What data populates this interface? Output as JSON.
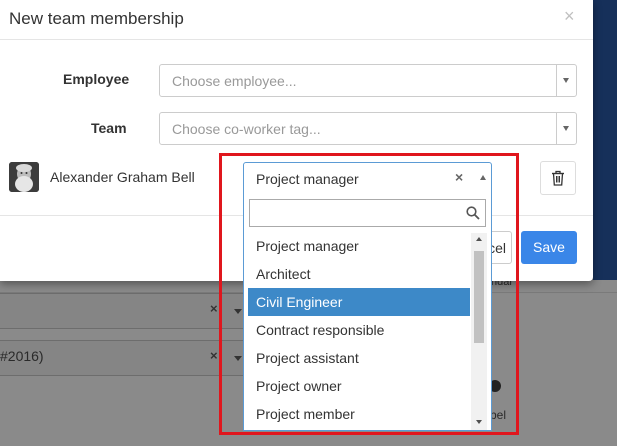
{
  "modal": {
    "title": "New team membership",
    "close_glyph": "×"
  },
  "form": {
    "employee_label": "Employee",
    "employee_placeholder": "Choose employee...",
    "team_label": "Team",
    "team_placeholder": "Choose co-worker tag..."
  },
  "member": {
    "name": "Alexander Graham Bell",
    "role_value": "Project manager",
    "clear_glyph": "×"
  },
  "dropdown": {
    "search_value": "",
    "options": [
      "Project manager",
      "Architect",
      "Civil Engineer",
      "Contract responsible",
      "Project assistant",
      "Project owner",
      "Project member"
    ],
    "highlighted_option": "Civil Engineer",
    "scroll_position": 0
  },
  "footer": {
    "cancel_label": "Cancel",
    "save_label": "Save"
  },
  "background": {
    "ref_text": "#2016)",
    "partial_text_1": "ndar",
    "partial_text_2": "bel",
    "x_glyph": "×"
  },
  "colors": {
    "primary": "#3a86e8",
    "highlight": "#3d89c8",
    "annotation_frame": "#e0161d",
    "focus_border": "#5b9bd5"
  },
  "icons": {
    "close": "close-icon",
    "clear": "clear-icon",
    "search": "search-icon",
    "trash": "trash-icon",
    "avatar": "avatar-portrait"
  }
}
